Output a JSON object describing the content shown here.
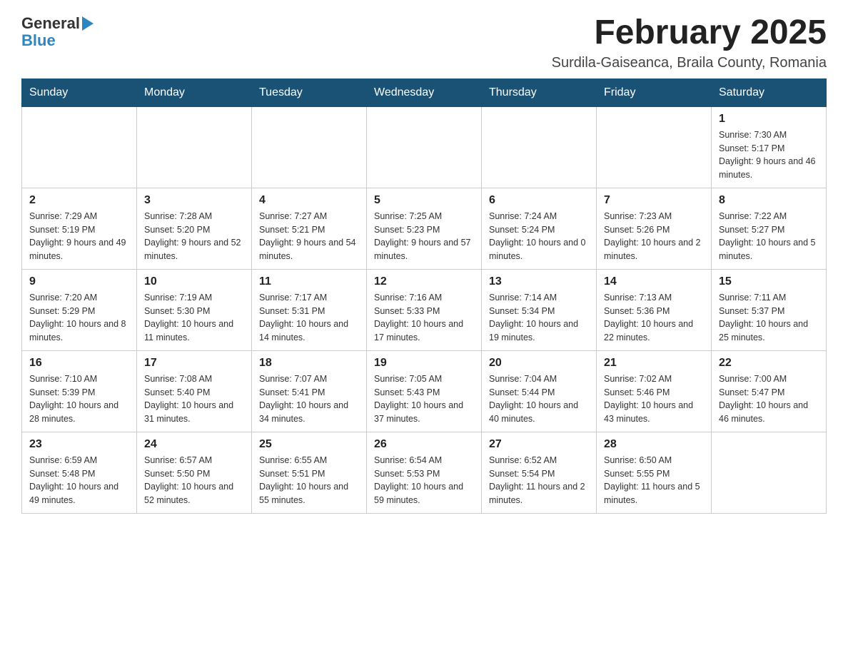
{
  "header": {
    "logo": {
      "general": "General",
      "blue": "Blue"
    },
    "title": "February 2025",
    "location": "Surdila-Gaiseanca, Braila County, Romania"
  },
  "weekdays": [
    "Sunday",
    "Monday",
    "Tuesday",
    "Wednesday",
    "Thursday",
    "Friday",
    "Saturday"
  ],
  "weeks": [
    [
      {
        "day": "",
        "info": ""
      },
      {
        "day": "",
        "info": ""
      },
      {
        "day": "",
        "info": ""
      },
      {
        "day": "",
        "info": ""
      },
      {
        "day": "",
        "info": ""
      },
      {
        "day": "",
        "info": ""
      },
      {
        "day": "1",
        "info": "Sunrise: 7:30 AM\nSunset: 5:17 PM\nDaylight: 9 hours and 46 minutes."
      }
    ],
    [
      {
        "day": "2",
        "info": "Sunrise: 7:29 AM\nSunset: 5:19 PM\nDaylight: 9 hours and 49 minutes."
      },
      {
        "day": "3",
        "info": "Sunrise: 7:28 AM\nSunset: 5:20 PM\nDaylight: 9 hours and 52 minutes."
      },
      {
        "day": "4",
        "info": "Sunrise: 7:27 AM\nSunset: 5:21 PM\nDaylight: 9 hours and 54 minutes."
      },
      {
        "day": "5",
        "info": "Sunrise: 7:25 AM\nSunset: 5:23 PM\nDaylight: 9 hours and 57 minutes."
      },
      {
        "day": "6",
        "info": "Sunrise: 7:24 AM\nSunset: 5:24 PM\nDaylight: 10 hours and 0 minutes."
      },
      {
        "day": "7",
        "info": "Sunrise: 7:23 AM\nSunset: 5:26 PM\nDaylight: 10 hours and 2 minutes."
      },
      {
        "day": "8",
        "info": "Sunrise: 7:22 AM\nSunset: 5:27 PM\nDaylight: 10 hours and 5 minutes."
      }
    ],
    [
      {
        "day": "9",
        "info": "Sunrise: 7:20 AM\nSunset: 5:29 PM\nDaylight: 10 hours and 8 minutes."
      },
      {
        "day": "10",
        "info": "Sunrise: 7:19 AM\nSunset: 5:30 PM\nDaylight: 10 hours and 11 minutes."
      },
      {
        "day": "11",
        "info": "Sunrise: 7:17 AM\nSunset: 5:31 PM\nDaylight: 10 hours and 14 minutes."
      },
      {
        "day": "12",
        "info": "Sunrise: 7:16 AM\nSunset: 5:33 PM\nDaylight: 10 hours and 17 minutes."
      },
      {
        "day": "13",
        "info": "Sunrise: 7:14 AM\nSunset: 5:34 PM\nDaylight: 10 hours and 19 minutes."
      },
      {
        "day": "14",
        "info": "Sunrise: 7:13 AM\nSunset: 5:36 PM\nDaylight: 10 hours and 22 minutes."
      },
      {
        "day": "15",
        "info": "Sunrise: 7:11 AM\nSunset: 5:37 PM\nDaylight: 10 hours and 25 minutes."
      }
    ],
    [
      {
        "day": "16",
        "info": "Sunrise: 7:10 AM\nSunset: 5:39 PM\nDaylight: 10 hours and 28 minutes."
      },
      {
        "day": "17",
        "info": "Sunrise: 7:08 AM\nSunset: 5:40 PM\nDaylight: 10 hours and 31 minutes."
      },
      {
        "day": "18",
        "info": "Sunrise: 7:07 AM\nSunset: 5:41 PM\nDaylight: 10 hours and 34 minutes."
      },
      {
        "day": "19",
        "info": "Sunrise: 7:05 AM\nSunset: 5:43 PM\nDaylight: 10 hours and 37 minutes."
      },
      {
        "day": "20",
        "info": "Sunrise: 7:04 AM\nSunset: 5:44 PM\nDaylight: 10 hours and 40 minutes."
      },
      {
        "day": "21",
        "info": "Sunrise: 7:02 AM\nSunset: 5:46 PM\nDaylight: 10 hours and 43 minutes."
      },
      {
        "day": "22",
        "info": "Sunrise: 7:00 AM\nSunset: 5:47 PM\nDaylight: 10 hours and 46 minutes."
      }
    ],
    [
      {
        "day": "23",
        "info": "Sunrise: 6:59 AM\nSunset: 5:48 PM\nDaylight: 10 hours and 49 minutes."
      },
      {
        "day": "24",
        "info": "Sunrise: 6:57 AM\nSunset: 5:50 PM\nDaylight: 10 hours and 52 minutes."
      },
      {
        "day": "25",
        "info": "Sunrise: 6:55 AM\nSunset: 5:51 PM\nDaylight: 10 hours and 55 minutes."
      },
      {
        "day": "26",
        "info": "Sunrise: 6:54 AM\nSunset: 5:53 PM\nDaylight: 10 hours and 59 minutes."
      },
      {
        "day": "27",
        "info": "Sunrise: 6:52 AM\nSunset: 5:54 PM\nDaylight: 11 hours and 2 minutes."
      },
      {
        "day": "28",
        "info": "Sunrise: 6:50 AM\nSunset: 5:55 PM\nDaylight: 11 hours and 5 minutes."
      },
      {
        "day": "",
        "info": ""
      }
    ]
  ]
}
